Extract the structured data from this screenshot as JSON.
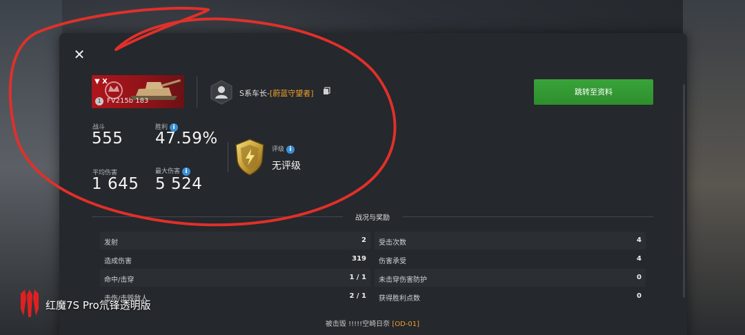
{
  "vehicle": {
    "tier": "▼ X",
    "name": "FV215b 183",
    "rank_badge": "1"
  },
  "player": {
    "name": "S系车长-",
    "clan": "[蔚蓝守望者]"
  },
  "profile_button": "跳转至资料",
  "stats": {
    "battles_label": "战斗",
    "battles_value": "555",
    "winrate_label": "胜利",
    "winrate_value": "47.59%",
    "avg_damage_label": "平均伤害",
    "avg_damage_value": "1 645",
    "max_damage_label": "最大伤害",
    "max_damage_value": "5 524"
  },
  "rating": {
    "label": "评级",
    "value": "无评级"
  },
  "section_title": "战况与奖励",
  "battle_rows_left": [
    {
      "label": "发射",
      "value": "2"
    },
    {
      "label": "造成伤害",
      "value": "319"
    },
    {
      "label": "命中/击穿",
      "value": "1 / 1"
    },
    {
      "label": "击伤/击毁敌人",
      "value": "2 / 1"
    }
  ],
  "battle_rows_right": [
    {
      "label": "受击次数",
      "value": "4"
    },
    {
      "label": "伤害承受",
      "value": "4"
    },
    {
      "label": "未击穿伤害防护",
      "value": "0"
    },
    {
      "label": "获得胜利点数",
      "value": "0"
    }
  ],
  "destroyed_by": {
    "prefix": "被击毁",
    "name": "!!!!!空崎日奈",
    "tag": "[OD-01]"
  },
  "watermark": "红魔7S Pro氘锋透明版",
  "colors": {
    "accent_green": "#3aa33a",
    "clan_orange": "#f0a030",
    "info_blue": "#3a8fd6",
    "annotation_red": "#e0302a"
  }
}
